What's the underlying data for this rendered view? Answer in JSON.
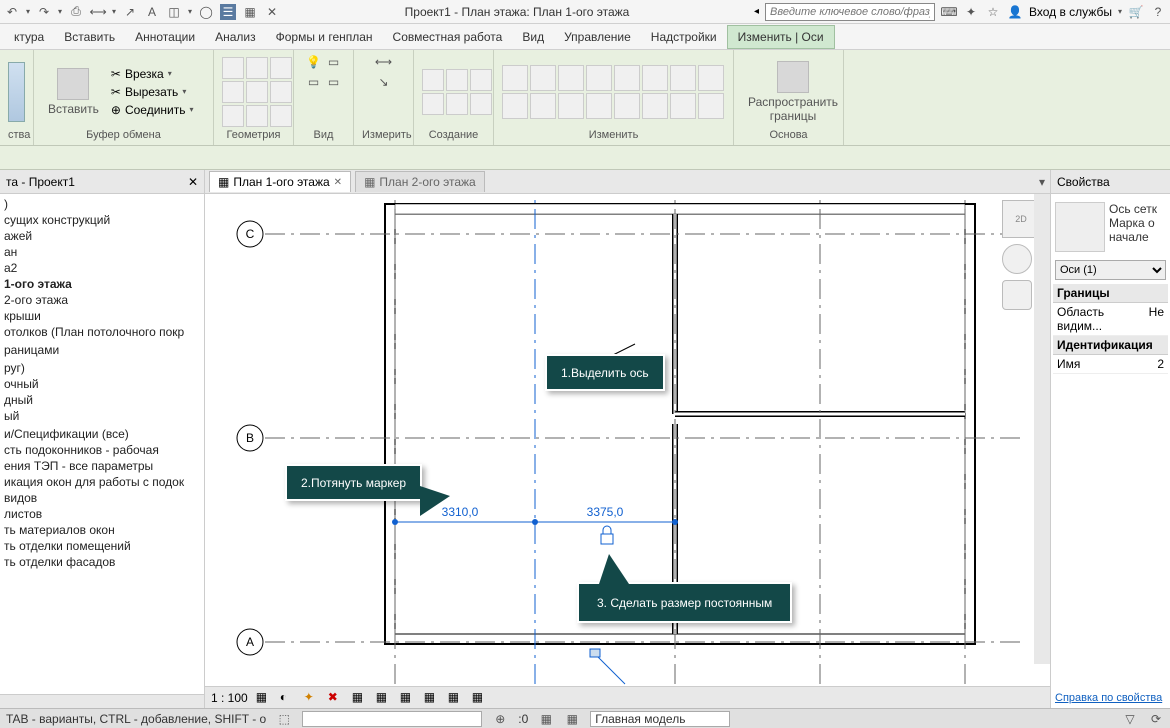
{
  "title": "Проект1 - План этажа: План 1-ого этажа",
  "search_placeholder": "Введите ключевое слово/фразу",
  "login_label": "Вход в службы",
  "menu": {
    "tabs": [
      "ктура",
      "Вставить",
      "Аннотации",
      "Анализ",
      "Формы и генплан",
      "Совместная работа",
      "Вид",
      "Управление",
      "Надстройки",
      "Изменить | Оси"
    ]
  },
  "ribbon": {
    "groups": [
      {
        "label": "ства"
      },
      {
        "label": "Буфер обмена",
        "insert": "Вставить",
        "cut_label": "Врезка",
        "cut2": "Вырезать",
        "join": "Соединить"
      },
      {
        "label": "Геометрия"
      },
      {
        "label": "Вид"
      },
      {
        "label": "Измерить"
      },
      {
        "label": "Создание"
      },
      {
        "label": "Изменить"
      },
      {
        "label": "Основа",
        "spread": "Распространить границы"
      }
    ]
  },
  "left_panel": {
    "title": "та - Проект1",
    "items": [
      ")",
      "сущих конструкций",
      "ажей",
      "ан",
      "а2",
      "1-ого этажа",
      "2-ого этажа",
      "крыши",
      "отолков (План потолочного покр",
      "",
      "раницами",
      "",
      "руг)",
      "очный",
      "дный",
      "ый",
      "",
      "и/Спецификации (все)",
      "сть подоконников - рабочая",
      "ения ТЭП - все параметры",
      "икация окон для работы с подок",
      "видов",
      "листов",
      "ть материалов окон",
      "ть отделки помещений",
      "ть отделки фасадов"
    ]
  },
  "view_tabs": [
    {
      "label": "План 1-ого этажа",
      "active": true
    },
    {
      "label": "План 2-ого этажа",
      "active": false
    }
  ],
  "canvas": {
    "grid_labels": [
      "C",
      "B",
      "A"
    ],
    "dim1": "3310,0",
    "dim2": "3375,0"
  },
  "callouts": [
    "1.Выделить ось",
    "2.Потянуть  маркер",
    "3. Сделать размер постоянным"
  ],
  "view_bar": {
    "zoom": "1 : 100"
  },
  "props": {
    "title": "Свойства",
    "desc1": "Ось сетк",
    "desc2": "Марка о",
    "desc3": "начале",
    "selector": "Оси (1)",
    "group1": "Границы",
    "row1_k": "Область видим...",
    "row1_v": "Не",
    "group2": "Идентификация",
    "row2_k": "Имя",
    "row2_v": "2",
    "help": "Справка по свойства"
  },
  "statusbar": {
    "hint": "TAB - варианты, CTRL - добавление, SHIFT - о",
    "coord": ":0",
    "model": "Главная модель"
  }
}
